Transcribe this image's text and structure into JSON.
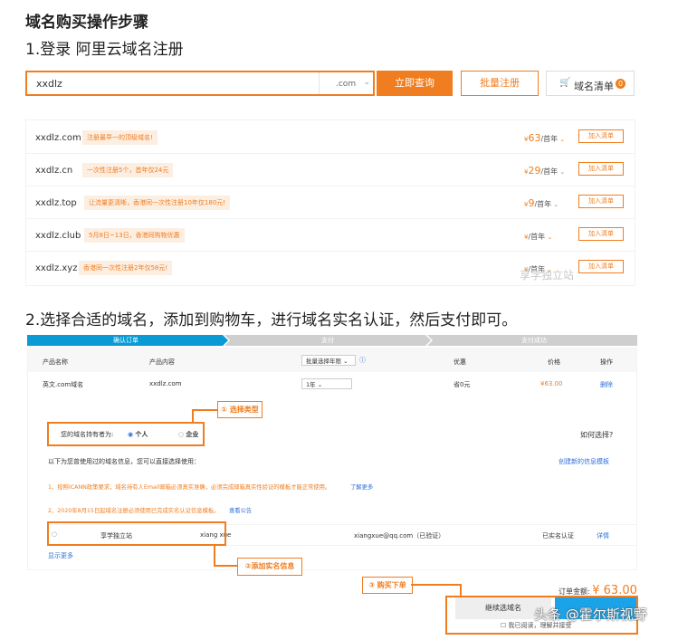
{
  "heading": "域名购买操作步骤",
  "step1_title": "1.登录 阿里云域名注册",
  "search": {
    "value": "xxdlz",
    "suffix": ".com",
    "query_button": "立即查询",
    "batch_button": "批量注册",
    "cart_button": "域名清单",
    "cart_count": "0"
  },
  "domains": [
    {
      "name": "xxdlz.com",
      "tag": "注册最早一的顶级域名!",
      "price": "63",
      "unit": "/首年"
    },
    {
      "name": "xxdlz.cn",
      "tag": "一次性注册5个，首年仅24元",
      "price": "29",
      "unit": "/首年"
    },
    {
      "name": "xxdlz.top",
      "tag": "让流量更清晰，香港同一次性注册10年仅180元!",
      "price": "9",
      "unit": "/首年"
    },
    {
      "name": "xxdlz.club",
      "tag": "5月8日~13日，香港同购物优惠",
      "price": "",
      "unit": "/首年"
    },
    {
      "name": "xxdlz.xyz",
      "tag": "香港同一次性注册2年仅58元!",
      "price": "",
      "unit": "/首年"
    }
  ],
  "add_to_list_label": "加入清单",
  "watermark1": "享学独立站",
  "step2_title": "2.选择合适的域名，添加到购物车，进行域名实名认证，然后支付即可。",
  "progress_steps": [
    "确认订单",
    "支付",
    "支付成功"
  ],
  "table": {
    "headers": [
      "产品名称",
      "产品内容",
      "批量选择年限",
      "优惠",
      "价格",
      "操作"
    ],
    "row": {
      "name": "英文.com域名",
      "content": "xxdlz.com",
      "years": "1年",
      "discount": "省0元",
      "price": "¥63.00",
      "action": "删除"
    }
  },
  "holder": {
    "question": "您的域名持有者为:",
    "personal": "个人",
    "company": "企业",
    "how_choose": "如何选择?",
    "info_text": "以下为您曾使用过的域名信息，您可以直接选择使用：",
    "create_template": "创建新的信息模板",
    "note1": "1、按照ICANN政策要求，域名持有人Email邮箱必须真实准确，必须完成邮箱真实性验证的模板才能正常使用。",
    "note1_link": "了解更多",
    "note2": "2、2020年8月15日起域名注册必须使用已完成实名认证信息模板。",
    "note2_link": "查看公告",
    "template_name": "享学独立站",
    "template_user": "xiang xue",
    "template_email": "xiangxue@qq.com（已验证）",
    "template_status": "已实名认证",
    "template_detail": "详情",
    "show_more": "显示更多"
  },
  "callouts": {
    "select_type": "① 选择类型",
    "add_realname": "②添加实名信息",
    "buy_order": "③ 购买下单"
  },
  "order": {
    "total_label": "订单金额:",
    "total_value": "¥ 63.00",
    "continue_button": "继续选域名",
    "agree_text": "我已阅读，理解并接受"
  },
  "watermark2": "头条 @霍尔斯视野",
  "colors": {
    "accent": "#f07d1f",
    "pay_blue": "#1aa3e8",
    "step_active": "#0a9bd5"
  }
}
